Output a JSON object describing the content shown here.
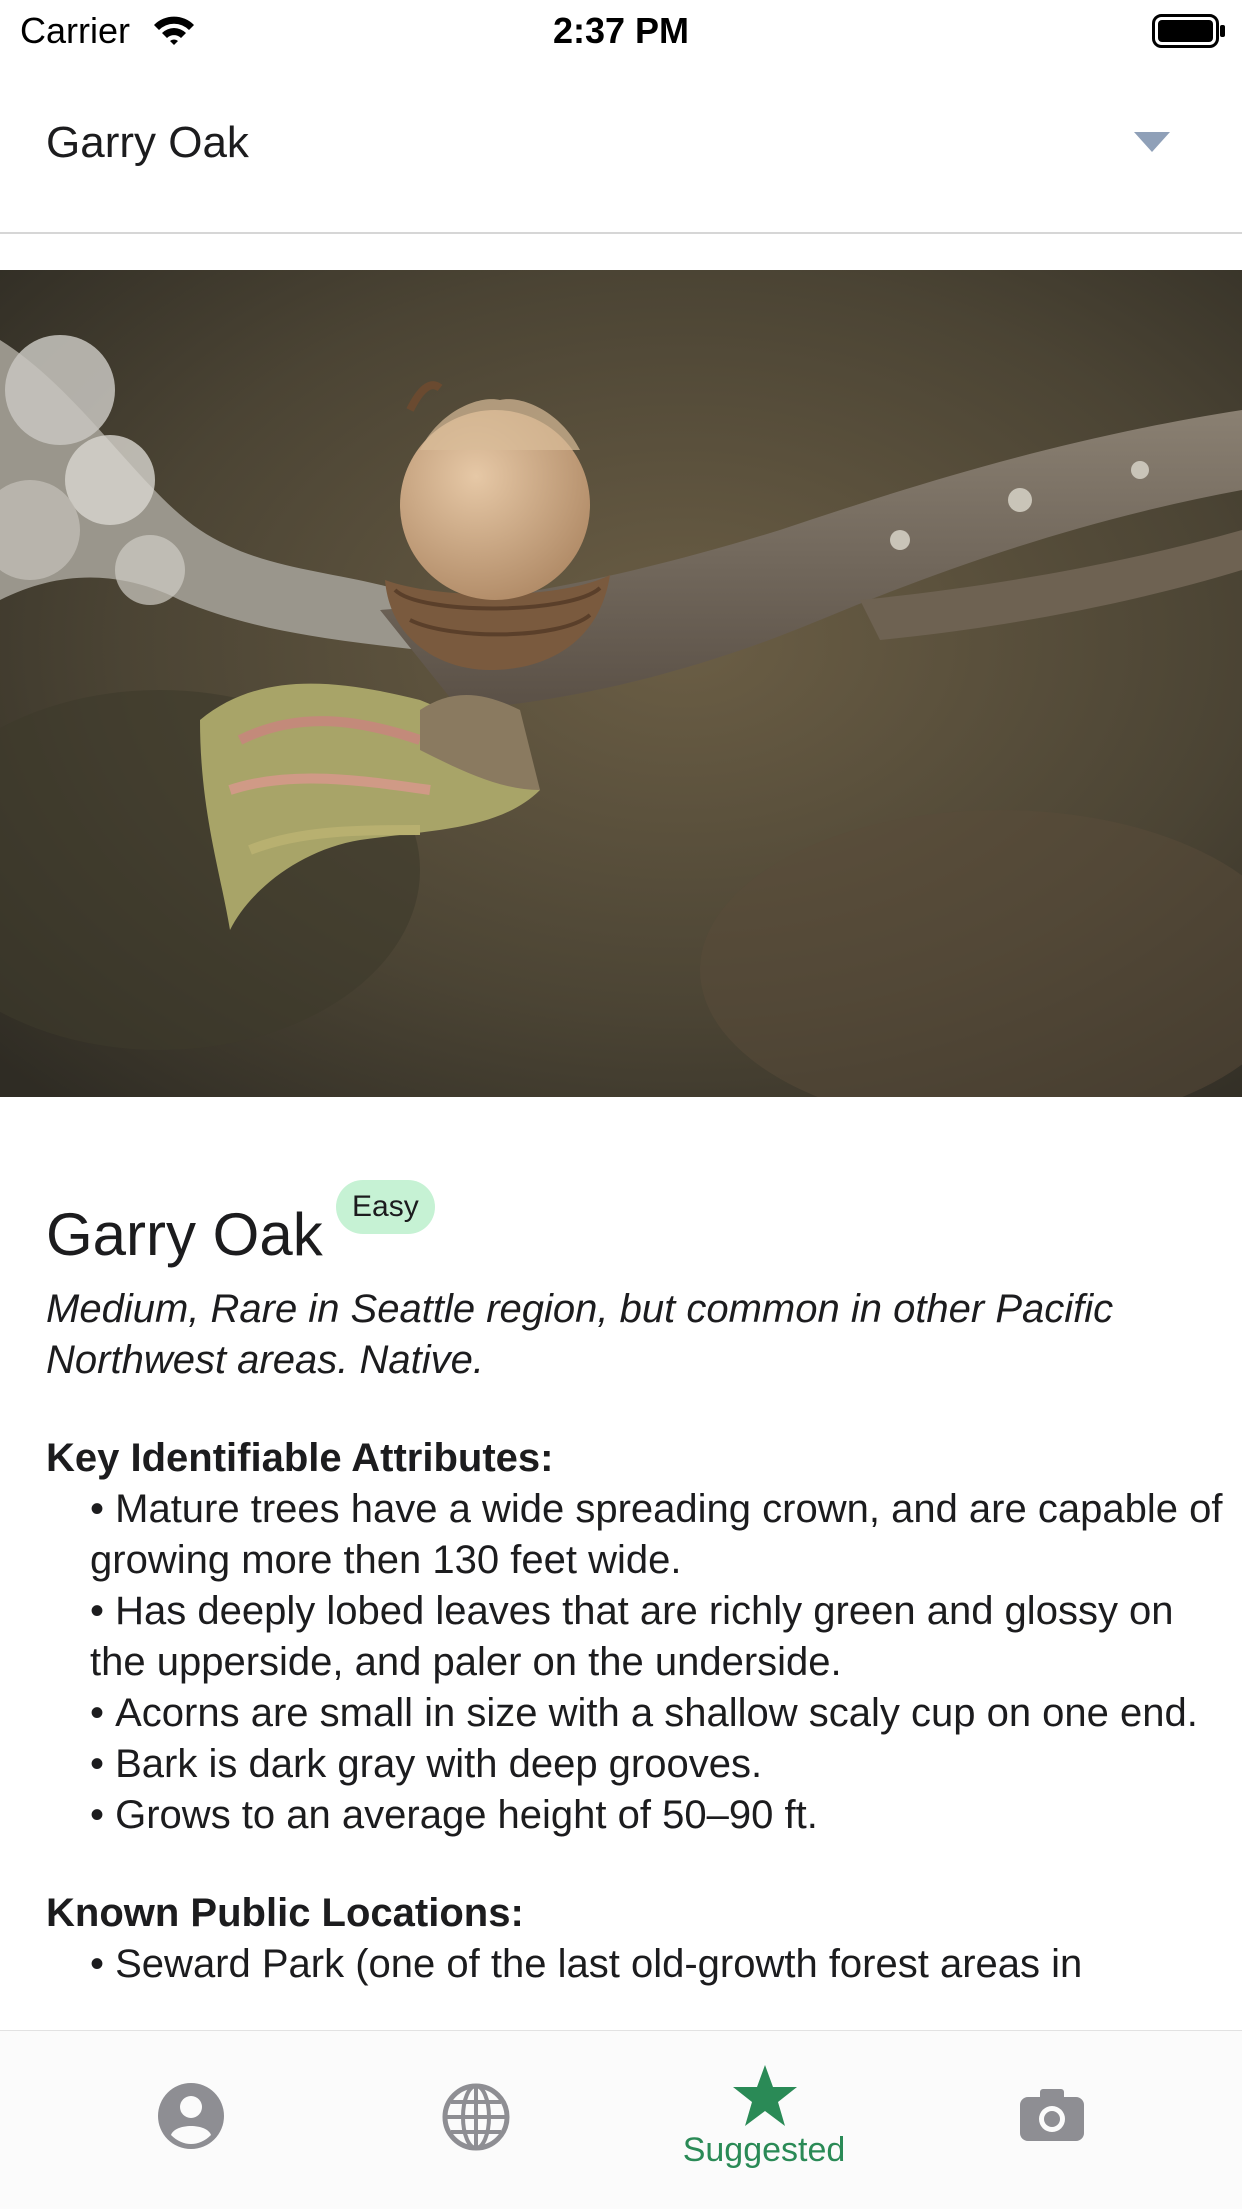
{
  "status_bar": {
    "carrier": "Carrier",
    "time": "2:37 PM"
  },
  "selector": {
    "value": "Garry Oak",
    "icon": "chevron-down-icon"
  },
  "hero_image": {
    "subject": "acorn-on-oak-branch"
  },
  "species": {
    "name": "Garry Oak",
    "difficulty": "Easy",
    "summary": "Medium, Rare in Seattle region, but common in other Pacific Northwest areas. Native.",
    "attributes_heading": "Key Identifiable Attributes:",
    "attributes": [
      "Mature trees have a wide spreading crown, and are capable of growing more then 130 feet wide.",
      "Has deeply lobed leaves that are richly green and glossy on the upperside, and paler on the underside.",
      "Acorns are small in size with a shallow scaly cup on one end.",
      "Bark is dark gray with deep grooves.",
      "Grows to an average height of 50–90 ft."
    ],
    "locations_heading": "Known Public Locations:",
    "locations": [
      "Seward Park (one of the last old-growth forest areas in"
    ]
  },
  "tab_bar": {
    "tabs": [
      {
        "icon": "person-icon",
        "label": ""
      },
      {
        "icon": "globe-icon",
        "label": ""
      },
      {
        "icon": "star-icon",
        "label": "Suggested",
        "selected": true
      },
      {
        "icon": "camera-icon",
        "label": ""
      }
    ]
  },
  "colors": {
    "accent": "#2a8a56",
    "badge_bg": "#c6f2d4",
    "inactive_icon": "#8e8e93",
    "chevron": "#8fa0b8"
  }
}
